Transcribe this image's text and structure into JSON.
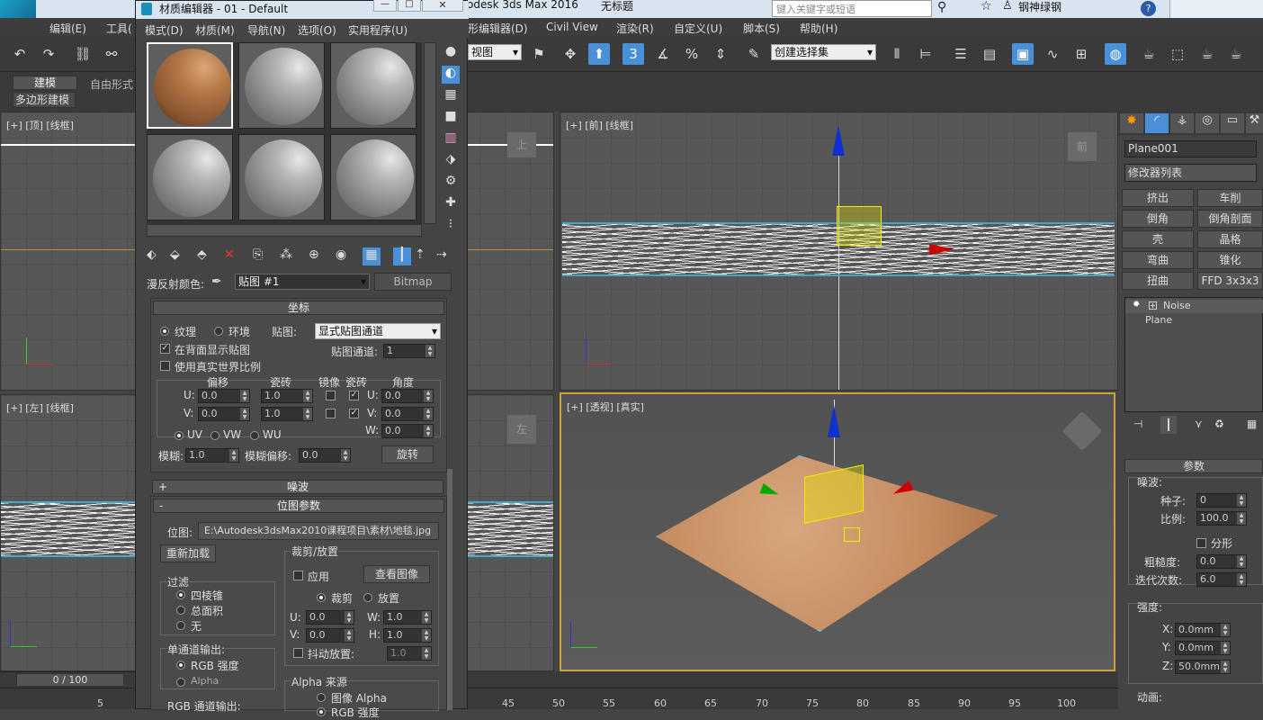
{
  "app": {
    "title": "odesk 3ds Max 2016",
    "doc_title": "无标题",
    "search_placeholder": "键入关键字或短语",
    "user": "钢神绿钢",
    "logo": "MAX"
  },
  "menubar": {
    "items": [
      "编辑(E)",
      "工具(",
      "形编辑器(D)",
      "Civil View",
      "渲染(R)",
      "自定义(U)",
      "脚本(S)",
      "帮助(H)"
    ]
  },
  "toolbar": {
    "view_dropdown": "视图",
    "selection_set": "创建选择集",
    "snap_value": "3"
  },
  "ribbon": {
    "tabs": [
      "建模",
      "自由形式"
    ],
    "sub": "多边形建模"
  },
  "viewports": {
    "top": {
      "label": "[+] [顶] [线框]",
      "cube": "上"
    },
    "front": {
      "label": "[+] [前] [线框]",
      "cube": "前"
    },
    "left": {
      "label": "[+] [左] [线框]",
      "cube": "左"
    },
    "persp": {
      "label": "[+] [透视] [真实]"
    }
  },
  "timeline": {
    "frame": "0 / 100",
    "ticks": [
      "5",
      "45",
      "50",
      "55",
      "60",
      "65",
      "70",
      "75",
      "80",
      "85",
      "90",
      "95",
      "100"
    ]
  },
  "cmdpanel": {
    "object_name": "Plane001",
    "modifier_list": "修改器列表",
    "buttons": [
      "挤出",
      "车削",
      "倒角",
      "倒角剖面",
      "壳",
      "晶格",
      "弯曲",
      "锥化",
      "扭曲",
      "FFD 3x3x3"
    ],
    "stack": [
      "Noise",
      "Plane"
    ],
    "params_title": "参数",
    "noise_label": "噪波:",
    "seed_label": "种子:",
    "seed": "0",
    "scale_label": "比例:",
    "scale": "100.0",
    "fractal_label": "分形",
    "roughness_label": "粗糙度:",
    "roughness": "0.0",
    "iterations_label": "迭代次数:",
    "iterations": "6.0",
    "strength_label": "强度:",
    "x_label": "X:",
    "x": "0.0mm",
    "y_label": "Y:",
    "y": "0.0mm",
    "z_label": "Z:",
    "z": "50.0mm",
    "anim_label": "动画:"
  },
  "mateditor": {
    "title": "材质编辑器 - 01 - Default",
    "menu": [
      "模式(D)",
      "材质(M)",
      "导航(N)",
      "选项(O)",
      "实用程序(U)"
    ],
    "diffuse_label": "漫反射颜色:",
    "map_name": "贴图 #1",
    "map_type": "Bitmap",
    "coords": {
      "title": "坐标",
      "texture": "纹理",
      "environ": "环境",
      "mapping_label": "贴图:",
      "mapping": "显式贴图通道",
      "show_back": "在背面显示贴图",
      "real_world": "使用真实世界比例",
      "channel_label": "贴图通道:",
      "channel": "1",
      "offset": "偏移",
      "tiling": "瓷砖",
      "mirror": "镜像",
      "tile": "瓷砖",
      "angle": "角度",
      "u_label": "U:",
      "v_label": "V:",
      "w_label": "W:",
      "u_offset": "0.0",
      "v_offset": "0.0",
      "u_tiling": "1.0",
      "v_tiling": "1.0",
      "u_angle": "0.0",
      "v_angle": "0.0",
      "w_angle": "0.0",
      "uv": "UV",
      "vw": "VW",
      "wu": "WU",
      "blur_label": "模糊:",
      "blur": "1.0",
      "blur_offset_label": "模糊偏移:",
      "blur_offset": "0.0",
      "rotate": "旋转"
    },
    "noise_title": "噪波",
    "bitmap_params": {
      "title": "位图参数",
      "bitmap_label": "位图:",
      "path": "E:\\Autodesk3dsMax2010课程项目\\素材\\地毯.jpg",
      "reload": "重新加载",
      "filter": "过滤",
      "pyramidal": "四棱锥",
      "summed": "总面积",
      "none": "无",
      "mono_out": "单通道输出:",
      "rgb_intensity": "RGB 强度",
      "alpha": "Alpha",
      "rgb_out": "RGB 通道输出:",
      "crop": "裁剪/放置",
      "apply": "应用",
      "view_image": "查看图像",
      "crop_opt": "裁剪",
      "place": "放置",
      "u_label": "U:",
      "v_label": "V:",
      "w_label": "W:",
      "h_label": "H:",
      "u": "0.0",
      "v": "0.0",
      "w": "1.0",
      "h": "1.0",
      "jitter": "抖动放置:",
      "jitter_val": "1.0",
      "alpha_source": "Alpha 来源",
      "image_alpha": "图像 Alpha",
      "rgb_intensity2": "RGB 强度"
    }
  }
}
